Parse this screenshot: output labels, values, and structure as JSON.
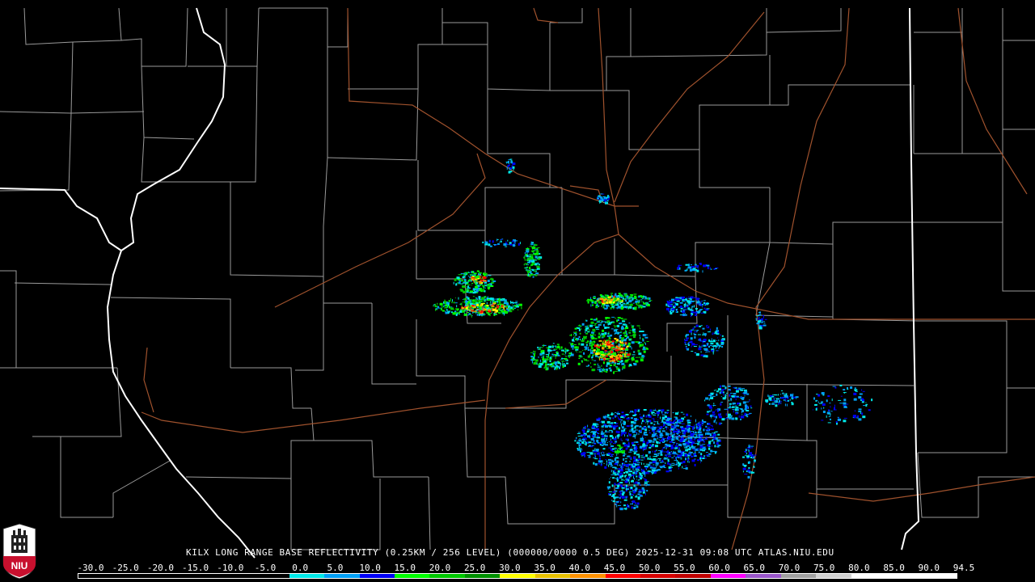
{
  "caption": {
    "text": "KILX LONG RANGE BASE REFLECTIVITY (0.25KM / 256 LEVEL) (000000/0000 0.5 DEG) 2025-12-31 09:08 UTC  ATLAS.NIU.EDU"
  },
  "logo": {
    "text": "NIU",
    "color": "#c8102e"
  },
  "colorbar": {
    "labels": [
      "-30.0",
      "-25.0",
      "-20.0",
      "-15.0",
      "-10.0",
      "-5.0",
      "0.0",
      "5.0",
      "10.0",
      "15.0",
      "20.0",
      "25.0",
      "30.0",
      "35.0",
      "40.0",
      "45.0",
      "50.0",
      "55.0",
      "60.0",
      "65.0",
      "70.0",
      "75.0",
      "80.0",
      "85.0",
      "90.0",
      "94.5"
    ],
    "colors": [
      "#000000",
      "#000000",
      "#000000",
      "#000000",
      "#000000",
      "#000000",
      "#00e8e8",
      "#009ff5",
      "#0000f6",
      "#00ff00",
      "#00c800",
      "#009000",
      "#ffff00",
      "#e7c000",
      "#ff9000",
      "#ff0000",
      "#d60000",
      "#c00000",
      "#ff00ff",
      "#9955c9",
      "#a0a0a0",
      "#d0d0d0",
      "#ffffff",
      "#ffffff",
      "#ffffff"
    ]
  },
  "map_colors": {
    "background": "#000000",
    "county_lines": "#9a9a9a",
    "state_lines": "#ffffff",
    "highways": "#a0522d"
  }
}
